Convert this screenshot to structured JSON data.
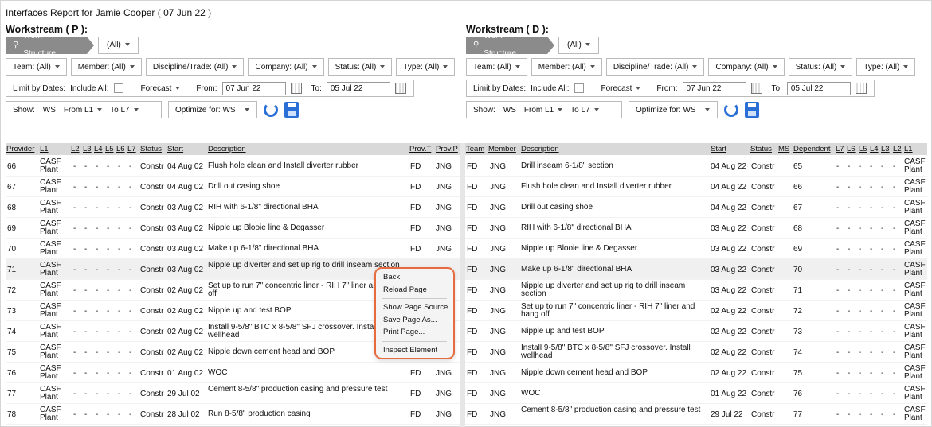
{
  "report_title": "Interfaces Report for Jamie Cooper ( 07 Jun 22 )",
  "panes": {
    "p": {
      "title": "Workstream ( P ):",
      "pill": "Work Structure",
      "pill_value": "(All)",
      "filters": [
        "Team: (All)",
        "Member: (All)",
        "Discipline/Trade: (All)",
        "Company: (All)",
        "Status: (All)",
        "Type: (All)"
      ],
      "limit_label": "Limit by Dates:",
      "include_all": "Include All:",
      "forecast": "Forecast",
      "from_label": "From:",
      "from_value": "07 Jun 22",
      "to_label": "To:",
      "to_value": "05 Jul 22",
      "show_label": "Show:",
      "show_ws": "WS",
      "show_from": "From L1",
      "show_to": "To L7",
      "optimize": "Optimize for:  WS"
    },
    "d": {
      "title": "Workstream ( D ):",
      "pill": "Work Structure",
      "pill_value": "(All)",
      "filters": [
        "Team: (All)",
        "Member: (All)",
        "Discipline/Trade: (All)",
        "Company: (All)",
        "Status: (All)",
        "Type: (All)"
      ],
      "limit_label": "Limit by Dates:",
      "include_all": "Include All:",
      "forecast": "Forecast",
      "from_label": "From:",
      "from_value": "07 Jun 22",
      "to_label": "To:",
      "to_value": "05 Jul 22",
      "show_label": "Show:",
      "show_ws": "WS",
      "show_from": "From L1",
      "show_to": "To L7",
      "optimize": "Optimize for:  WS"
    }
  },
  "left_headers": [
    "Provider",
    "L1",
    "L2",
    "L3",
    "L4",
    "L5",
    "L6",
    "L7",
    "Status",
    "Start",
    "Description",
    "Prov.T",
    "Prov.P"
  ],
  "right_headers": [
    "Team",
    "Member",
    "Description",
    "Start",
    "Status",
    "MS",
    "Dependent",
    "L7",
    "L6",
    "L5",
    "L4",
    "L3",
    "L2",
    "L1"
  ],
  "left_rows": [
    {
      "provider": "66",
      "l1": "CASF Plant",
      "status": "Constr",
      "start": "04 Aug 02",
      "desc": "Flush hole clean and Install diverter rubber",
      "prov_t": "FD",
      "prov_p": "JNG"
    },
    {
      "provider": "67",
      "l1": "CASF Plant",
      "status": "Constr",
      "start": "04 Aug 02",
      "desc": "Drill out casing shoe",
      "prov_t": "FD",
      "prov_p": "JNG"
    },
    {
      "provider": "68",
      "l1": "CASF Plant",
      "status": "Constr",
      "start": "03 Aug 02",
      "desc": "RIH with 6-1/8\" directional BHA",
      "prov_t": "FD",
      "prov_p": "JNG"
    },
    {
      "provider": "69",
      "l1": "CASF Plant",
      "status": "Constr",
      "start": "03 Aug 02",
      "desc": "Nipple up Blooie line & Degasser",
      "prov_t": "FD",
      "prov_p": "JNG"
    },
    {
      "provider": "70",
      "l1": "CASF Plant",
      "status": "Constr",
      "start": "03 Aug 02",
      "desc": "Make up 6-1/8\" directional BHA",
      "prov_t": "FD",
      "prov_p": "JNG"
    },
    {
      "provider": "71",
      "l1": "CASF Plant",
      "status": "Constr",
      "start": "03 Aug 02",
      "desc": "Nipple up diverter and set up rig to drill inseam section",
      "prov_t": "",
      "prov_p": ""
    },
    {
      "provider": "72",
      "l1": "CASF Plant",
      "status": "Constr",
      "start": "02 Aug 02",
      "desc": "Set up to run 7\" concentric liner - RIH 7\" liner and hang off",
      "prov_t": "",
      "prov_p": ""
    },
    {
      "provider": "73",
      "l1": "CASF Plant",
      "status": "Constr",
      "start": "02 Aug 02",
      "desc": "Nipple up and test BOP",
      "prov_t": "",
      "prov_p": ""
    },
    {
      "provider": "74",
      "l1": "CASF Plant",
      "status": "Constr",
      "start": "02 Aug 02",
      "desc": "Install 9-5/8\" BTC x 8-5/8\" SFJ crossover. Install wellhead",
      "prov_t": "",
      "prov_p": ""
    },
    {
      "provider": "75",
      "l1": "CASF Plant",
      "status": "Constr",
      "start": "02 Aug 02",
      "desc": "Nipple down cement head and BOP",
      "prov_t": "",
      "prov_p": ""
    },
    {
      "provider": "76",
      "l1": "CASF Plant",
      "status": "Constr",
      "start": "01 Aug 02",
      "desc": "WOC",
      "prov_t": "FD",
      "prov_p": "JNG"
    },
    {
      "provider": "77",
      "l1": "CASF Plant",
      "status": "Constr",
      "start": "29 Jul 02",
      "desc": "Cement 8-5/8\" production casing and pressure test",
      "prov_t": "FD",
      "prov_p": "JNG"
    },
    {
      "provider": "78",
      "l1": "CASF Plant",
      "status": "Constr",
      "start": "28 Jul 02",
      "desc": "Run 8-5/8\" production casing",
      "prov_t": "FD",
      "prov_p": "JNG"
    }
  ],
  "right_rows": [
    {
      "team": "FD",
      "member": "JNG",
      "desc": "Drill inseam 6-1/8\" section",
      "start": "04 Aug 22",
      "status": "Constr",
      "dependent": "65",
      "l1": "CASF Plant"
    },
    {
      "team": "FD",
      "member": "JNG",
      "desc": "Flush hole clean and Install diverter rubber",
      "start": "04 Aug 22",
      "status": "Constr",
      "dependent": "66",
      "l1": "CASF Plant"
    },
    {
      "team": "FD",
      "member": "JNG",
      "desc": "Drill out casing shoe",
      "start": "04 Aug 22",
      "status": "Constr",
      "dependent": "67",
      "l1": "CASF Plant"
    },
    {
      "team": "FD",
      "member": "JNG",
      "desc": "RIH with 6-1/8\" directional BHA",
      "start": "03 Aug 22",
      "status": "Constr",
      "dependent": "68",
      "l1": "CASF Plant"
    },
    {
      "team": "FD",
      "member": "JNG",
      "desc": "Nipple up Blooie line & Degasser",
      "start": "03 Aug 22",
      "status": "Constr",
      "dependent": "69",
      "l1": "CASF Plant"
    },
    {
      "team": "FD",
      "member": "JNG",
      "desc": "Make up 6-1/8\" directional BHA",
      "start": "03 Aug 22",
      "status": "Constr",
      "dependent": "70",
      "l1": "CASF Plant"
    },
    {
      "team": "FD",
      "member": "JNG",
      "desc": "Nipple up diverter and set up rig to drill inseam section",
      "start": "03 Aug 22",
      "status": "Constr",
      "dependent": "71",
      "l1": "CASF Plant"
    },
    {
      "team": "FD",
      "member": "JNG",
      "desc": "Set up to run 7\" concentric liner - RIH 7\" liner and hang off",
      "start": "02 Aug 22",
      "status": "Constr",
      "dependent": "72",
      "l1": "CASF Plant"
    },
    {
      "team": "FD",
      "member": "JNG",
      "desc": "Nipple up and test BOP",
      "start": "02 Aug 22",
      "status": "Constr",
      "dependent": "73",
      "l1": "CASF Plant"
    },
    {
      "team": "FD",
      "member": "JNG",
      "desc": "Install 9-5/8\" BTC x 8-5/8\" SFJ crossover. Install wellhead",
      "start": "02 Aug 22",
      "status": "Constr",
      "dependent": "74",
      "l1": "CASF Plant"
    },
    {
      "team": "FD",
      "member": "JNG",
      "desc": "Nipple down cement head and BOP",
      "start": "02 Aug 22",
      "status": "Constr",
      "dependent": "75",
      "l1": "CASF Plant"
    },
    {
      "team": "FD",
      "member": "JNG",
      "desc": "WOC",
      "start": "01 Aug 22",
      "status": "Constr",
      "dependent": "76",
      "l1": "CASF Plant"
    },
    {
      "team": "FD",
      "member": "JNG",
      "desc": "Cement 8-5/8\" production casing and pressure test",
      "start": "29 Jul 22",
      "status": "Constr",
      "dependent": "77",
      "l1": "CASF Plant"
    }
  ],
  "dash": "-",
  "context_menu": {
    "items": [
      "Back",
      "Reload Page",
      "Show Page Source",
      "Save Page As...",
      "Print Page...",
      "Inspect Element"
    ]
  }
}
